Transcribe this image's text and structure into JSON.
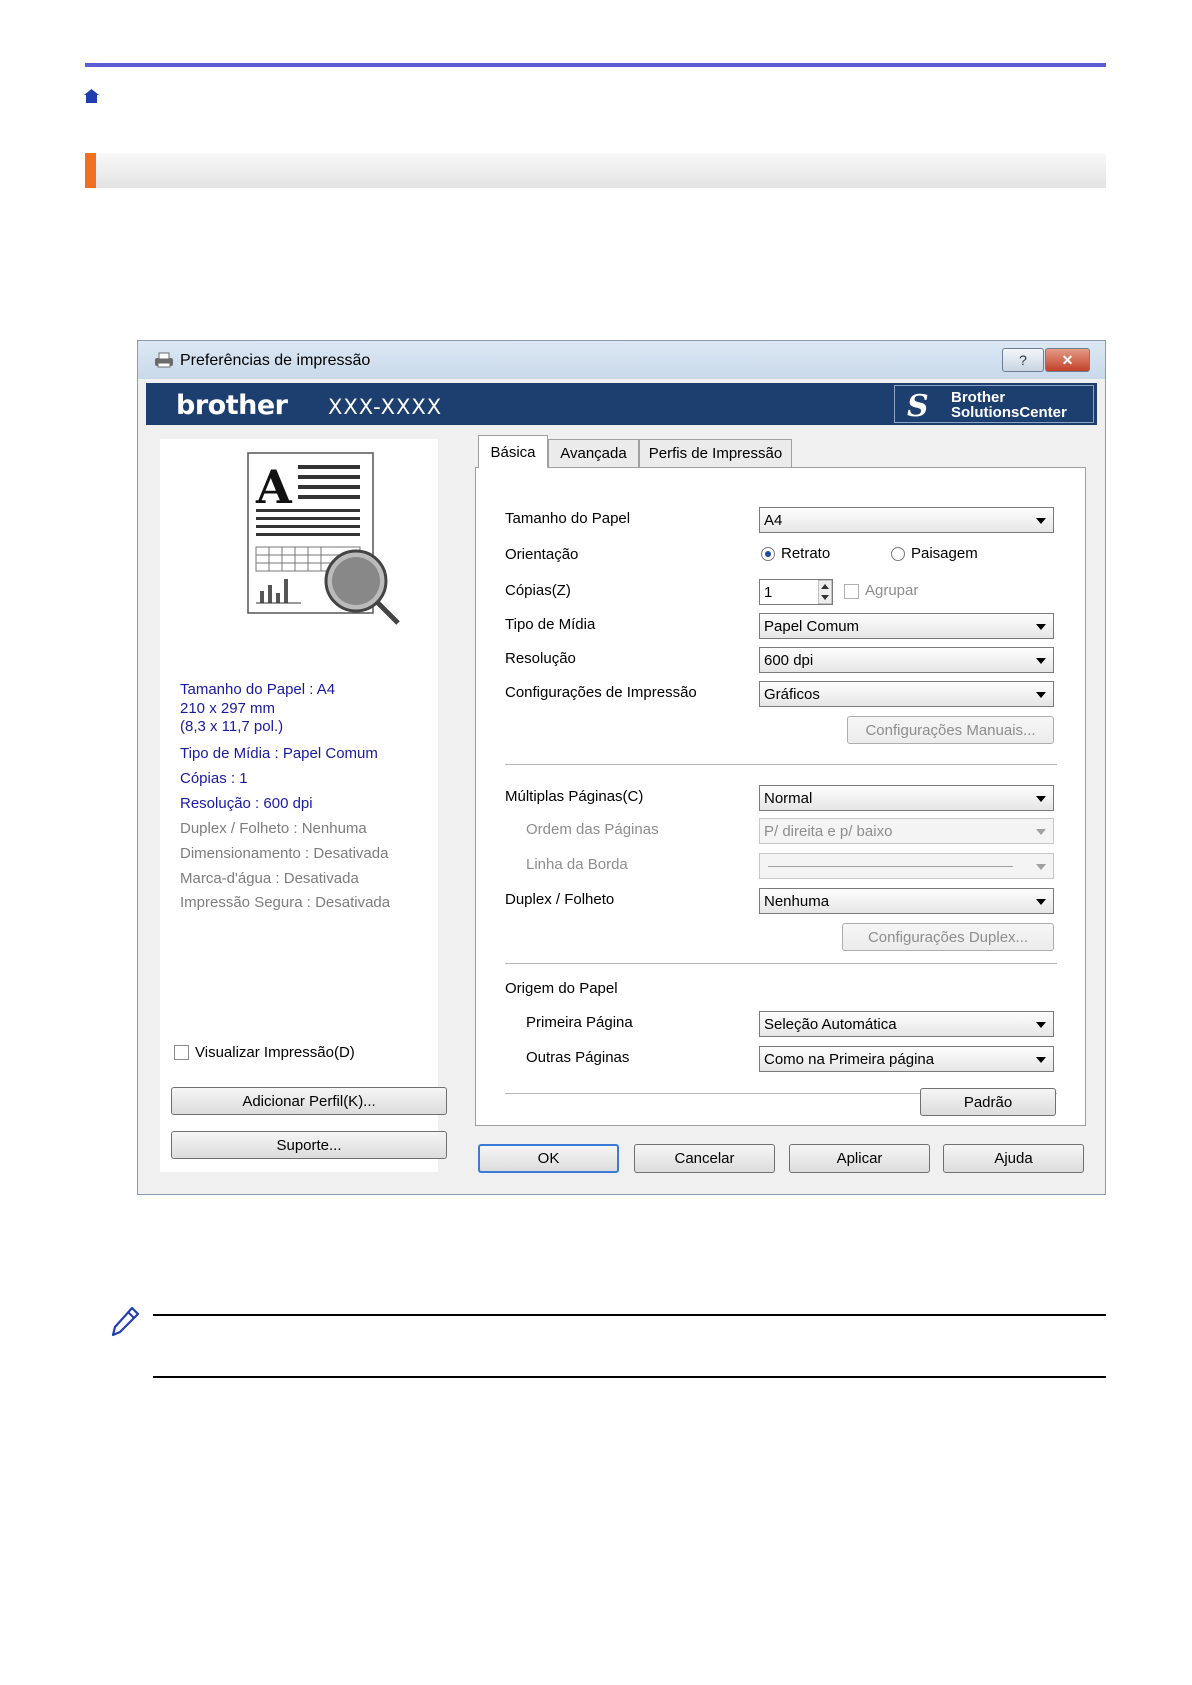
{
  "dialog": {
    "title": "Preferências de impressão",
    "help_label": "?",
    "close_label": "✕",
    "brand": "brother",
    "model": "XXX-XXXX",
    "solutions_center_line1": "Brother",
    "solutions_center_line2": "SolutionsCenter"
  },
  "left": {
    "info": [
      "Tamanho do Papel : A4",
      "210 x 297 mm",
      "(8,3 x 11,7 pol.)",
      "Tipo de Mídia : Papel Comum",
      "Cópias : 1",
      "Resolução : 600 dpi",
      "Duplex / Folheto : Nenhuma",
      "Dimensionamento : Desativada",
      "Marca-d'água : Desativada",
      "Impressão Segura : Desativada"
    ],
    "preview_checkbox": "Visualizar Impressão(D)",
    "add_profile_button": "Adicionar Perfil(K)...",
    "support_button": "Suporte..."
  },
  "tabs": [
    "Básica",
    "Avançada",
    "Perfis de Impressão"
  ],
  "basic": {
    "paper_size_label": "Tamanho do Papel",
    "paper_size_value": "A4",
    "orientation_label": "Orientação",
    "portrait": "Retrato",
    "landscape": "Paisagem",
    "copies_label": "Cópias(Z)",
    "copies_value": "1",
    "collate": "Agrupar",
    "media_type_label": "Tipo de Mídia",
    "media_type_value": "Papel Comum",
    "resolution_label": "Resolução",
    "resolution_value": "600 dpi",
    "print_settings_label": "Configurações de Impressão",
    "print_settings_value": "Gráficos",
    "manual_settings_button": "Configurações Manuais...",
    "multiple_pages_label": "Múltiplas Páginas(C)",
    "multiple_pages_value": "Normal",
    "page_order_label": "Ordem das Páginas",
    "page_order_value": "P/ direita e p/ baixo",
    "border_line_label": "Linha da Borda",
    "duplex_label": "Duplex / Folheto",
    "duplex_value": "Nenhuma",
    "duplex_settings_button": "Configurações Duplex...",
    "paper_source_label": "Origem do Papel",
    "first_page_label": "Primeira Página",
    "first_page_value": "Seleção Automática",
    "other_pages_label": "Outras Páginas",
    "other_pages_value": "Como na Primeira página",
    "default_button": "Padrão"
  },
  "footer": {
    "ok": "OK",
    "cancel": "Cancelar",
    "apply": "Aplicar",
    "help": "Ajuda"
  },
  "colors": {
    "brand_bar": "#1c3f70",
    "top_rule": "#5b5fd1",
    "section_accent": "#f26f21",
    "info_text": "#1a1aa0"
  }
}
